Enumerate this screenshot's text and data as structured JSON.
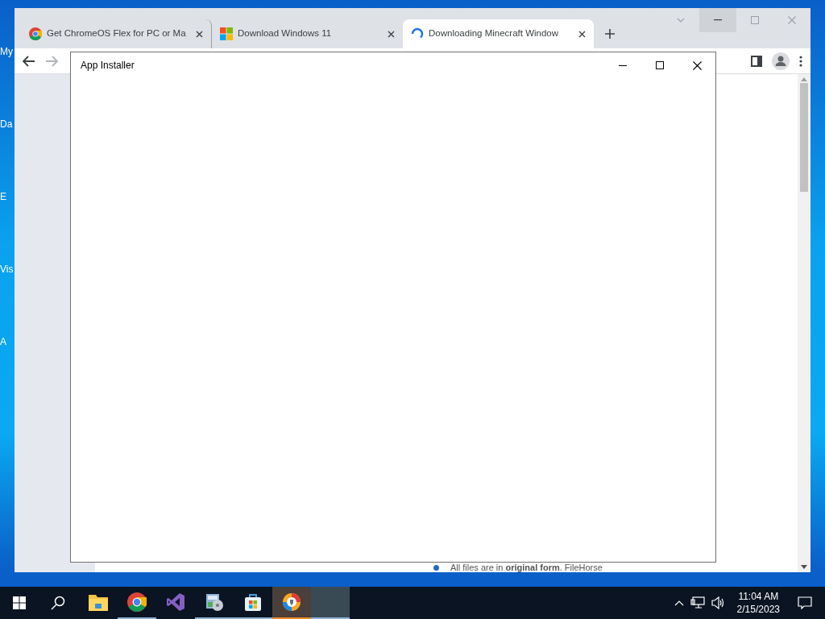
{
  "desktop_icons": [
    {
      "label": "My"
    },
    {
      "label": "Da"
    },
    {
      "label": "E"
    },
    {
      "label": "Vis"
    },
    {
      "label": "A"
    }
  ],
  "browser": {
    "tabs": [
      {
        "kind": "chrome",
        "title": "Get ChromeOS Flex for PC or Ma",
        "selected": false
      },
      {
        "kind": "windows",
        "title": "Download Windows 11",
        "selected": false
      },
      {
        "kind": "loading",
        "title": "Downloading Minecraft Window",
        "selected": true
      }
    ],
    "page": {
      "bullet": "All files are in **original form**. FileHorse"
    }
  },
  "dialog": {
    "title": "App Installer"
  },
  "taskbar": {
    "apps": [
      {
        "kind": "explorer",
        "running": false,
        "highlighted": false
      },
      {
        "kind": "chrome",
        "running": true,
        "highlighted": false
      },
      {
        "kind": "studio",
        "running": false,
        "highlighted": false
      },
      {
        "kind": "installer",
        "running": true,
        "highlighted": false
      },
      {
        "kind": "store",
        "running": true,
        "highlighted": false
      },
      {
        "kind": "secure",
        "running": true,
        "highlighted": true
      },
      {
        "kind": "blank",
        "running": true,
        "highlighted": true
      }
    ],
    "clock": {
      "time": "11:04 AM",
      "date": "2/15/2023"
    }
  }
}
